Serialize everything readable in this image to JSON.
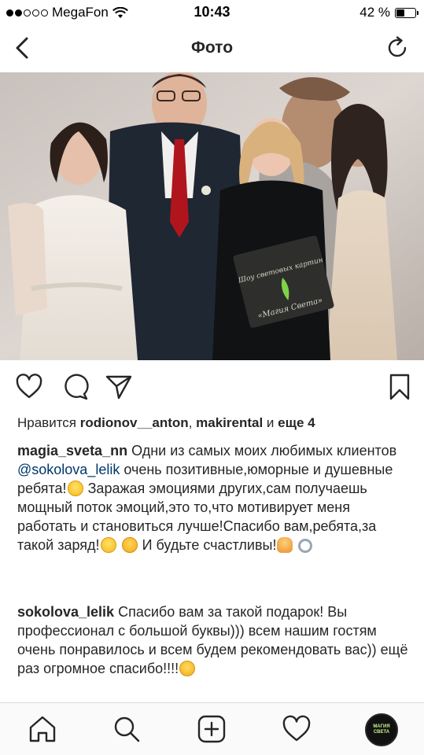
{
  "status_bar": {
    "carrier": "MegaFon",
    "time": "10:43",
    "battery_percent": "42 %",
    "battery_level": 0.42,
    "signal_bars": 2
  },
  "nav": {
    "title": "Фото"
  },
  "likes": {
    "prefix": "Нравится",
    "user1": "rodionov__anton",
    "separator": ",",
    "user2": "makirental",
    "conjunction": "и",
    "more": "еще 4"
  },
  "caption": {
    "username": "magia_sveta_nn",
    "text_before_mention": "Одни из самых моих любимых клиентов",
    "mention": "@sokolova_lelik",
    "text_part1": "очень позитивные,юморные и душевные ребята!",
    "text_part2": "Заражая эмоциями других,сам получаешь мощный поток эмоций,это то,что мотивирует меня работать и становиться лучше!Спасибо вам,ребята,за такой заряд!",
    "text_part3": "И будьте счастливы!"
  },
  "comment": {
    "username": "sokolova_lelik",
    "text": "Спасибо вам за такой подарок! Вы профессионал с большой буквы))) всем нашим гостям очень понравилось и всем будем рекомендовать вас)) ещё раз огромное спасибо!!!!"
  },
  "photo": {
    "book_line1": "Шоу световых картин",
    "book_line2": "«Магия Света»"
  },
  "profile_avatar": {
    "line1": "МАГИЯ",
    "line2": "СВЕТА"
  },
  "icons": {
    "back": "chevron-left-icon",
    "refresh": "refresh-icon",
    "like": "heart-icon",
    "comment": "comment-bubble-icon",
    "share": "paper-plane-icon",
    "save": "bookmark-icon",
    "home": "home-icon",
    "search": "search-icon",
    "add": "add-post-icon",
    "activity": "heart-icon"
  },
  "colors": {
    "text": "#262626",
    "mention": "#00376b",
    "divider": "#dbdbdb"
  }
}
